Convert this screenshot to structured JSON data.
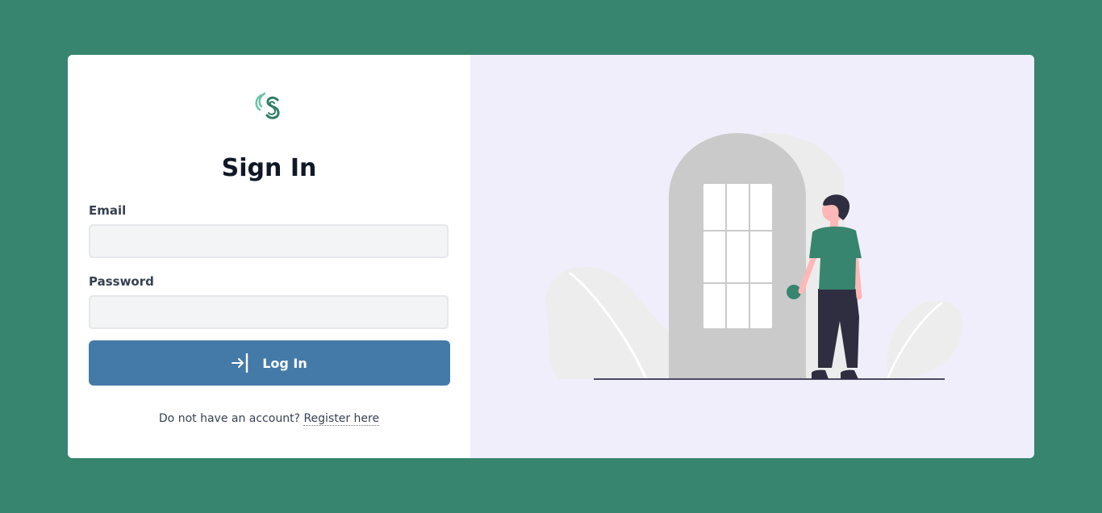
{
  "form": {
    "title": "Sign In",
    "email_label": "Email",
    "email_value": "",
    "password_label": "Password",
    "password_value": "",
    "submit_label": "Log In"
  },
  "footer": {
    "prompt": "Do not have an account?",
    "register_link": "Register here"
  },
  "colors": {
    "page_background": "#37856e",
    "primary_button": "#447aa8",
    "illustration_background": "#f0eefa",
    "accent_green": "#37856e"
  },
  "icons": {
    "logo": "brand-s-logo-icon",
    "submit": "login-arrow-icon"
  }
}
